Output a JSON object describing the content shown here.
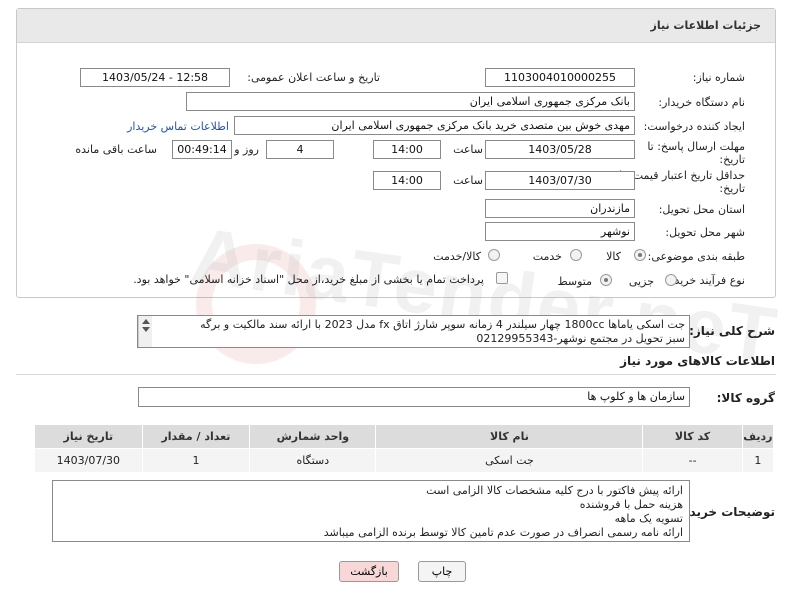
{
  "panel": {
    "title": "جزئیات اطلاعات نیاز"
  },
  "fields": {
    "need_number_label": "شماره نیاز:",
    "need_number": "1103004010000255",
    "announce_label": "تاریخ و ساعت اعلان عمومی:",
    "announce_value": "1403/05/24 - 12:58",
    "buyer_org_label": "نام دستگاه خریدار:",
    "buyer_org": "بانک مرکزی جمهوری اسلامی ایران",
    "requester_label": "ایجاد کننده درخواست:",
    "requester": "مهدی خوش بین متصدی خرید بانک مرکزی جمهوری اسلامی ایران",
    "contact_link": "اطلاعات تماس خریدار",
    "deadline_label_1": "مهلت ارسال پاسخ: تا",
    "deadline_label_2": "تاریخ:",
    "deadline_date": "1403/05/28",
    "time_label": "ساعت",
    "deadline_time": "14:00",
    "days_value": "4",
    "days_label": "روز و",
    "remaining_time": "00:49:14",
    "remaining_label": "ساعت باقی مانده",
    "validity_label_1": "حداقل تاریخ اعتبار قیمت: تا",
    "validity_label_2": "تاریخ:",
    "validity_date": "1403/07/30",
    "validity_time": "14:00",
    "province_label": "استان محل تحویل:",
    "province": "مازندران",
    "city_label": "شهر محل تحویل:",
    "city": "نوشهر",
    "category_label": "طبقه بندی موضوعی:",
    "category_options": [
      "کالا",
      "خدمت",
      "کالا/خدمت"
    ],
    "process_label": "نوع فرآیند خرید :",
    "process_options": [
      "جزیی",
      "متوسط"
    ],
    "payment_note": "پرداخت تمام یا بخشی از مبلغ خرید،از محل \"اسناد خزانه اسلامی\" خواهد بود."
  },
  "summary": {
    "label": "شرح کلی نیاز:",
    "text_line1": "جت اسکی یاماها 1800cc چهار سیلندر 4 زمانه سوپر شارژ اتاق fx مدل 2023 با ارائه سند مالکیت و برگه",
    "text_line2": "سبز تحویل در مجتمع نوشهر-02129955343"
  },
  "goods_section": {
    "title": "اطلاعات کالاهای مورد نیاز",
    "group_label": "گروه کالا:",
    "group_value": "سازمان ها و کلوپ ها",
    "columns": [
      "ردیف",
      "کد کالا",
      "نام کالا",
      "واحد شمارش",
      "تعداد / مقدار",
      "تاریخ نیاز"
    ],
    "rows": [
      {
        "row": "1",
        "code": "--",
        "name": "جت اسکی",
        "unit": "دستگاه",
        "qty": "1",
        "date": "1403/07/30"
      }
    ]
  },
  "buyer_notes": {
    "label": "توضیحات خریدار:",
    "lines": [
      "ارائه پیش فاکتور با درج کلیه مشخصات کالا الزامی است",
      "هزینه حمل با فروشنده",
      "تسویه یک ماهه",
      "ارائه نامه رسمی انصراف در صورت عدم تامین کالا توسط برنده الزامی میباشد"
    ]
  },
  "buttons": {
    "print": "چاپ",
    "back": "بازگشت"
  },
  "watermark": "AriaTender.neT",
  "colors": {
    "link": "#2255aa",
    "back_button_bg": "#f7d7d7",
    "header_bg": "#e9e9e9"
  }
}
